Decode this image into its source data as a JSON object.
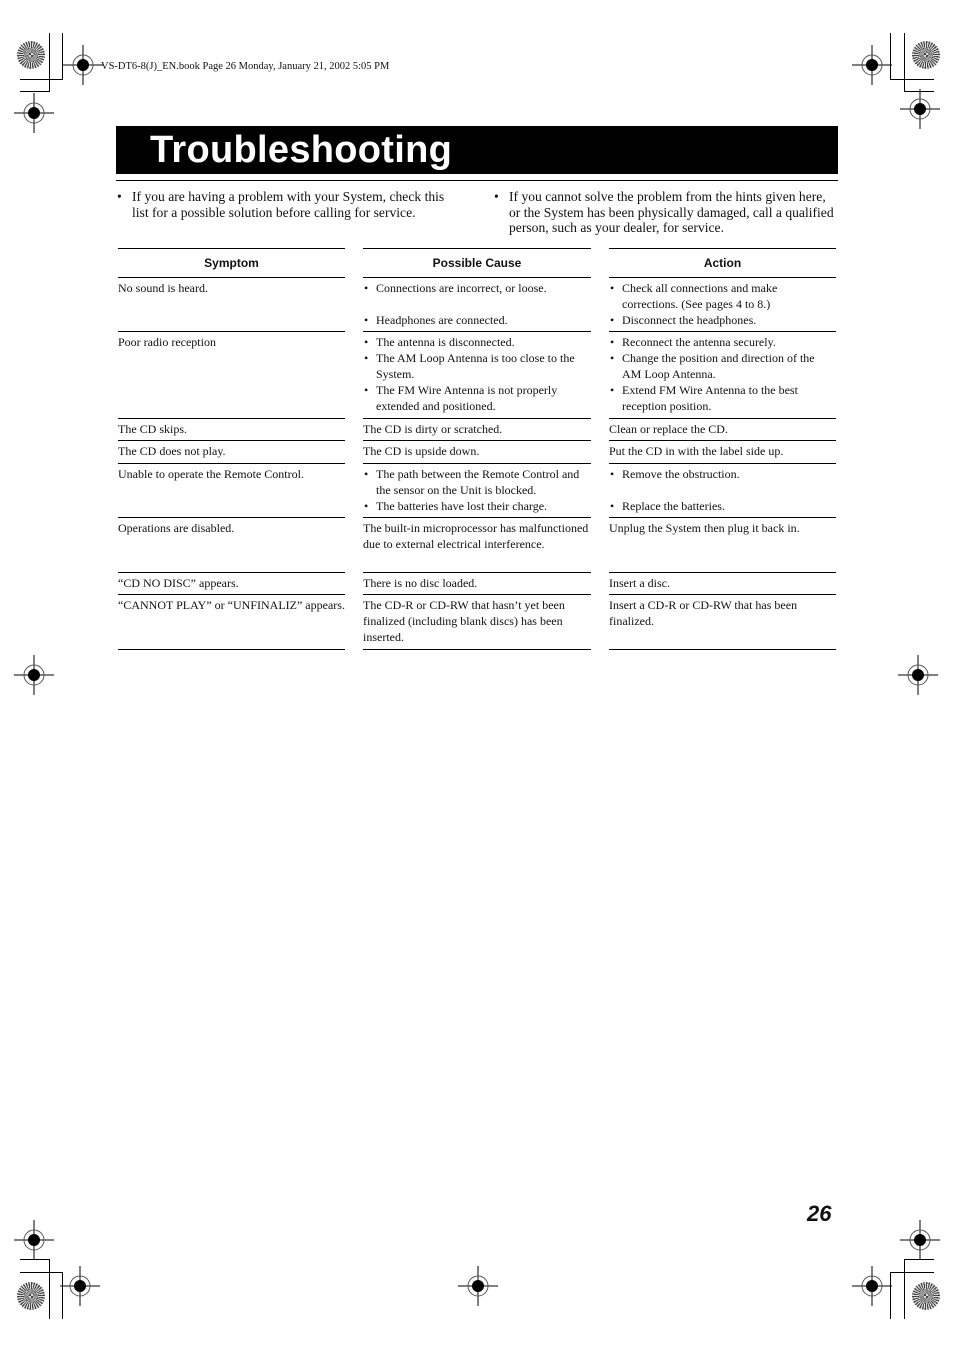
{
  "running_header": "VS-DT6-8(J)_EN.book  Page 26  Monday, January 21, 2002  5:05 PM",
  "title": "Troubleshooting",
  "intro": {
    "left": "If you are having a problem with your System, check this list for a possible solution before calling for service.",
    "right": "If you cannot solve the problem from the hints given here, or the System has been physically damaged, call a qualified person, such as your dealer, for service."
  },
  "table": {
    "headers": {
      "symptom": "Symptom",
      "cause": "Possible Cause",
      "action": "Action"
    },
    "rows": [
      {
        "symptom": "No sound is heard.",
        "causes": [
          "Connections are incorrect, or loose.",
          "",
          "Headphones are connected."
        ],
        "actions": [
          "Check all connections and make corrections. (See pages 4 to 8.)",
          "Disconnect the headphones."
        ]
      },
      {
        "symptom": "Poor radio reception",
        "causes": [
          "The antenna is disconnected.",
          "The AM Loop Antenna is too close to the System.",
          "The FM Wire Antenna is not properly extended and positioned."
        ],
        "actions": [
          "Reconnect the antenna securely.",
          "Change the position and direction of the AM Loop Antenna.",
          "Extend FM Wire Antenna to the best reception position."
        ]
      },
      {
        "symptom": "The CD skips.",
        "cause": "The CD is dirty or scratched.",
        "action": "Clean or replace the CD."
      },
      {
        "symptom": "The CD does not play.",
        "cause": "The CD is upside down.",
        "action": "Put the CD in with the label side up."
      },
      {
        "symptom": "Unable to operate the Remote Control.",
        "causes": [
          "The path between the Remote Control and the sensor on the Unit is blocked.",
          "The batteries have lost their charge."
        ],
        "actions": [
          "Remove the obstruction.",
          "",
          "Replace the batteries."
        ]
      },
      {
        "symptom": "Operations are disabled.",
        "cause": "The built-in microprocessor has malfunctioned due to external electrical interference.",
        "action": "Unplug the System then plug it back in."
      },
      {
        "symptom": "“CD NO DISC” appears.",
        "cause": "There is no disc loaded.",
        "action": "Insert a disc."
      },
      {
        "symptom": "“CANNOT PLAY” or “UNFINALIZ” appears.",
        "cause": "The CD-R or CD-RW that hasn’t yet been finalized (including blank discs) has been inserted.",
        "action": "Insert a CD-R or CD-RW that has been finalized."
      }
    ]
  },
  "bullet": "•",
  "page_number": "26"
}
